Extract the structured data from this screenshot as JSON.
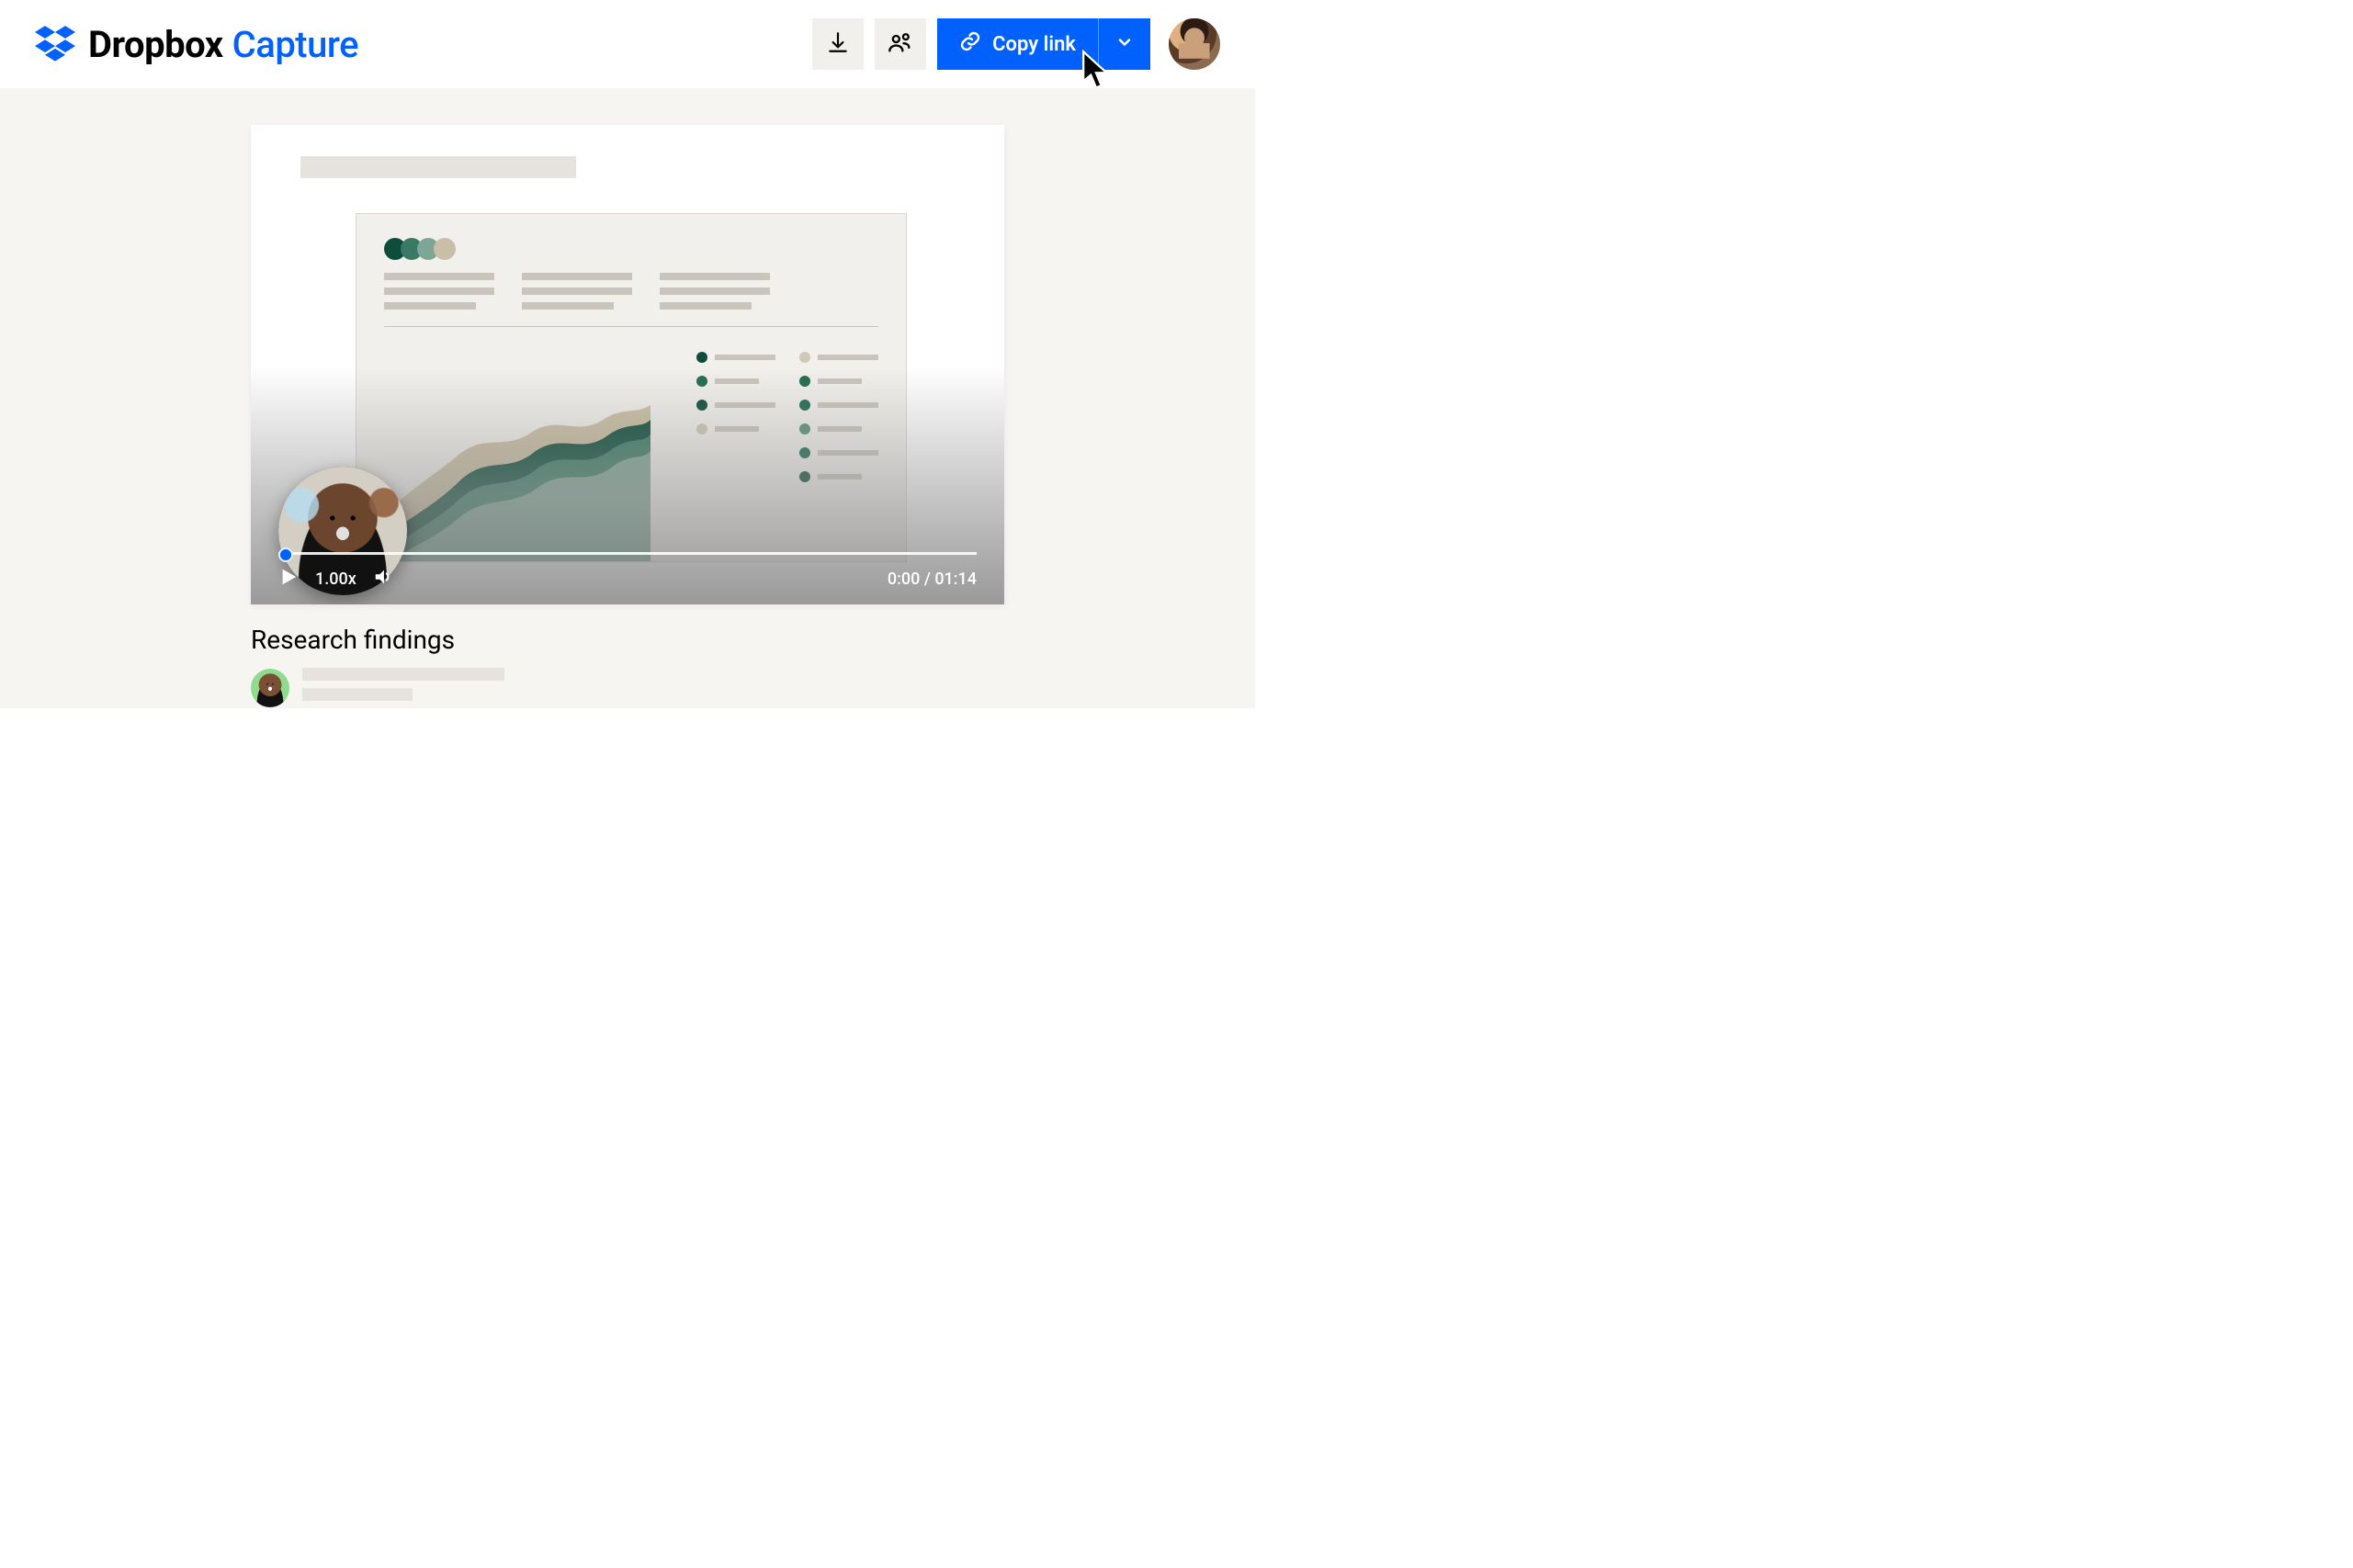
{
  "brand": {
    "name": "Dropbox",
    "product": "Capture"
  },
  "header": {
    "download_label": "Download",
    "share_label": "Share",
    "copy_link_label": "Copy link"
  },
  "player": {
    "speed": "1.00x",
    "current_time": "0:00",
    "duration": "01:14"
  },
  "video": {
    "title": "Research findings"
  },
  "slide": {
    "legend_colors_left": [
      "#0e4d3b",
      "#1f6b52",
      "#0e4d3b",
      "#cfc8b6"
    ],
    "legend_colors_right": [
      "#cfc8b6",
      "#1f6b52",
      "#1f6b52",
      "#5a8f7a",
      "#1f6b52",
      "#0e4d3b"
    ]
  },
  "colors": {
    "accent": "#0061ff",
    "surface": "#f7f5f2",
    "button_bg": "#f2f0ec"
  }
}
